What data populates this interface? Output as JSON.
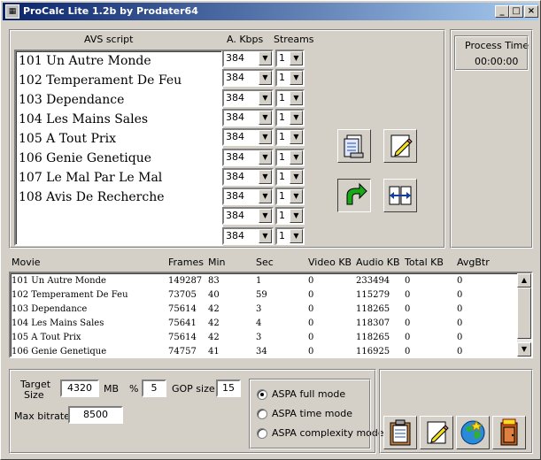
{
  "window": {
    "title": "ProCalc Lite 1.2b by Prodater64",
    "min": "_",
    "max": "□",
    "close": "×"
  },
  "avs": {
    "header": "AVS script",
    "kbps_header": "A. Kbps",
    "streams_header": "Streams",
    "items": [
      "101 Un Autre Monde",
      "102 Temperament De Feu",
      "103 Dependance",
      "104 Les Mains Sales",
      "105 A Tout Prix",
      "106 Genie Genetique",
      "107 Le Mal Par Le Mal",
      "108 Avis De Recherche"
    ],
    "rows": [
      {
        "kbps": "384",
        "streams": "1"
      },
      {
        "kbps": "384",
        "streams": "1"
      },
      {
        "kbps": "384",
        "streams": "1"
      },
      {
        "kbps": "384",
        "streams": "1"
      },
      {
        "kbps": "384",
        "streams": "1"
      },
      {
        "kbps": "384",
        "streams": "1"
      },
      {
        "kbps": "384",
        "streams": "1"
      },
      {
        "kbps": "384",
        "streams": "1"
      },
      {
        "kbps": "384",
        "streams": "1"
      },
      {
        "kbps": "384",
        "streams": "1"
      }
    ]
  },
  "process_time": {
    "label": "Process Time",
    "value": "00:00:00"
  },
  "movies": {
    "columns": [
      "Movie",
      "Frames",
      "Min",
      "Sec",
      "Video KB",
      "Audio KB",
      "Total KB",
      "AvgBtr"
    ],
    "rows": [
      [
        "101 Un Autre Monde",
        "149287",
        "83",
        "1",
        "0",
        "233494",
        "0",
        "0"
      ],
      [
        "102 Temperament De Feu",
        "73705",
        "40",
        "59",
        "0",
        "115279",
        "0",
        "0"
      ],
      [
        "103 Dependance",
        "75614",
        "42",
        "3",
        "0",
        "118265",
        "0",
        "0"
      ],
      [
        "104 Les Mains Sales",
        "75641",
        "42",
        "4",
        "0",
        "118307",
        "0",
        "0"
      ],
      [
        "105 A Tout Prix",
        "75614",
        "42",
        "3",
        "0",
        "118265",
        "0",
        "0"
      ],
      [
        "106 Genie Genetique",
        "74757",
        "41",
        "34",
        "0",
        "116925",
        "0",
        "0"
      ]
    ]
  },
  "settings": {
    "target_label_1": "Target",
    "target_label_2": "Size",
    "target_value": "4320",
    "mb_label": "MB",
    "pct_label": "%",
    "pct_value": "5",
    "gop_label": "GOP size",
    "gop_value": "15",
    "maxbitrate_label": "Max bitrate:",
    "maxbitrate_value": "8500"
  },
  "modes": {
    "selected": 0,
    "options": [
      "ASPA full mode",
      "ASPA time mode",
      "ASPA complexity mode"
    ]
  },
  "icons": {
    "copy": "copy-icon",
    "edit": "edit-icon",
    "undo": "undo-arrow-icon",
    "swap": "swap-icon",
    "clipboard": "clipboard-icon",
    "notepad": "notepad-icon",
    "globe": "globe-icon",
    "exit": "exit-door-icon"
  },
  "colors": {
    "title_start": "#0a246a",
    "title_end": "#a6caf0",
    "face": "#d4d0c8",
    "undo_green": "#18a818"
  }
}
